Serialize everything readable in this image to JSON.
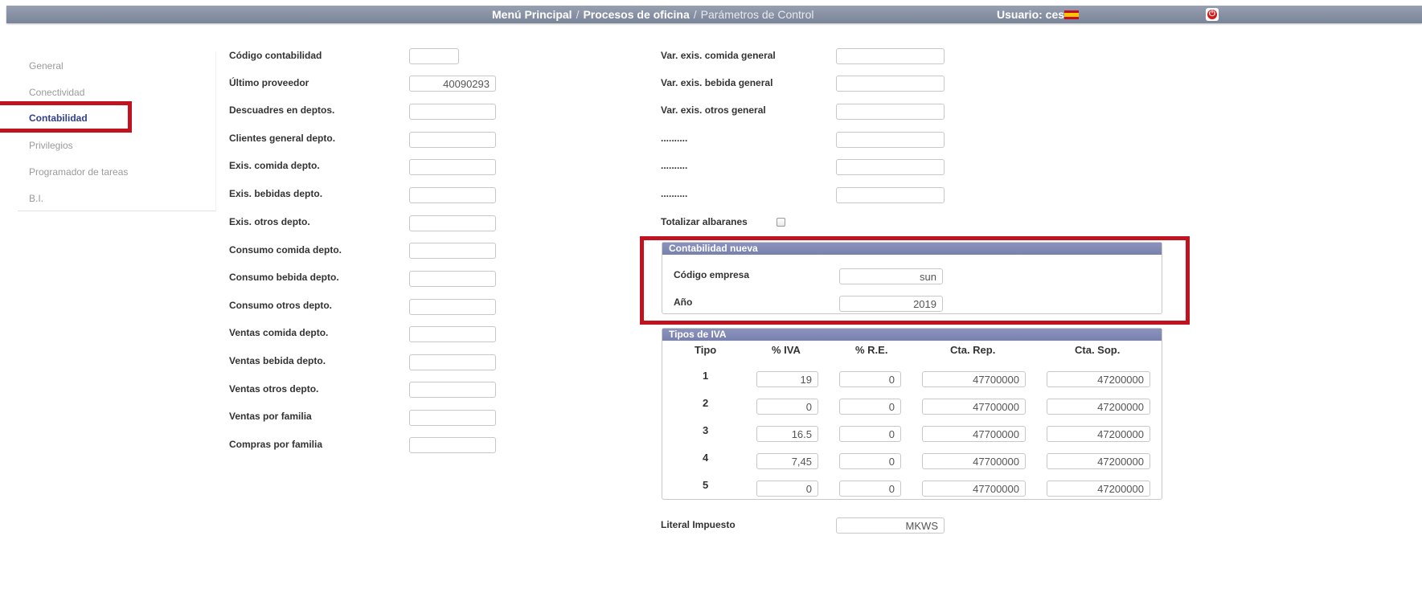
{
  "header": {
    "breadcrumb_home": "Menú Principal",
    "breadcrumb_section": "Procesos de oficina",
    "breadcrumb_current": "Parámetros de Control",
    "separator": "/",
    "user": "Usuario: cesar",
    "flag_icon": "spain-flag-icon",
    "power_icon": "power-icon"
  },
  "sidebar": {
    "items": [
      {
        "label": "General"
      },
      {
        "label": "Conectividad"
      },
      {
        "label": "Contabilidad",
        "active": true
      },
      {
        "label": "Privilegios"
      },
      {
        "label": "Programador de tareas"
      },
      {
        "label": "B.I."
      }
    ]
  },
  "left_form": [
    {
      "label": "Código contabilidad",
      "value": ""
    },
    {
      "label": "Último proveedor",
      "value": "40090293"
    },
    {
      "label": "Descuadres en deptos.",
      "value": ""
    },
    {
      "label": "Clientes general depto.",
      "value": ""
    },
    {
      "label": "Exis. comida depto.",
      "value": ""
    },
    {
      "label": "Exis. bebidas depto.",
      "value": ""
    },
    {
      "label": "Exis. otros depto.",
      "value": ""
    },
    {
      "label": "Consumo comida depto.",
      "value": ""
    },
    {
      "label": "Consumo bebida depto.",
      "value": ""
    },
    {
      "label": "Consumo otros depto.",
      "value": ""
    },
    {
      "label": "Ventas comida depto.",
      "value": ""
    },
    {
      "label": "Ventas bebida depto.",
      "value": ""
    },
    {
      "label": "Ventas otros depto.",
      "value": ""
    },
    {
      "label": "Ventas por familia",
      "value": ""
    },
    {
      "label": "Compras por familia",
      "value": ""
    }
  ],
  "right_form": [
    {
      "label": "Var. exis. comida general",
      "value": ""
    },
    {
      "label": "Var. exis. bebida general",
      "value": ""
    },
    {
      "label": "Var. exis. otros general",
      "value": ""
    },
    {
      "label": "..........",
      "value": ""
    },
    {
      "label": "..........",
      "value": ""
    },
    {
      "label": "..........",
      "value": ""
    }
  ],
  "totalizar": {
    "label": "Totalizar albaranes",
    "checked": false
  },
  "contabilidad_nueva": {
    "title": "Contabilidad nueva",
    "codigo_label": "Código empresa",
    "codigo_value": "sun",
    "anio_label": "Año",
    "anio_value": "2019"
  },
  "tipos_iva": {
    "title": "Tipos de IVA",
    "headers": [
      "Tipo",
      "% IVA",
      "% R.E.",
      "Cta. Rep.",
      "Cta. Sop."
    ],
    "rows": [
      {
        "tipo": "1",
        "iva": "19",
        "re": "0",
        "rep": "47700000",
        "sop": "47200000"
      },
      {
        "tipo": "2",
        "iva": "0",
        "re": "0",
        "rep": "47700000",
        "sop": "47200000"
      },
      {
        "tipo": "3",
        "iva": "16.5",
        "re": "0",
        "rep": "47700000",
        "sop": "47200000"
      },
      {
        "tipo": "4",
        "iva": "7,45",
        "re": "0",
        "rep": "47700000",
        "sop": "47200000"
      },
      {
        "tipo": "5",
        "iva": "0",
        "re": "0",
        "rep": "47700000",
        "sop": "47200000"
      }
    ]
  },
  "literal_impuesto": {
    "label": "Literal Impuesto",
    "value": "MKWS"
  },
  "colors": {
    "header": "#8a93a6",
    "accent": "#2e3f8e",
    "highlight": "#c1121f",
    "panel_header": "#8088b5"
  }
}
